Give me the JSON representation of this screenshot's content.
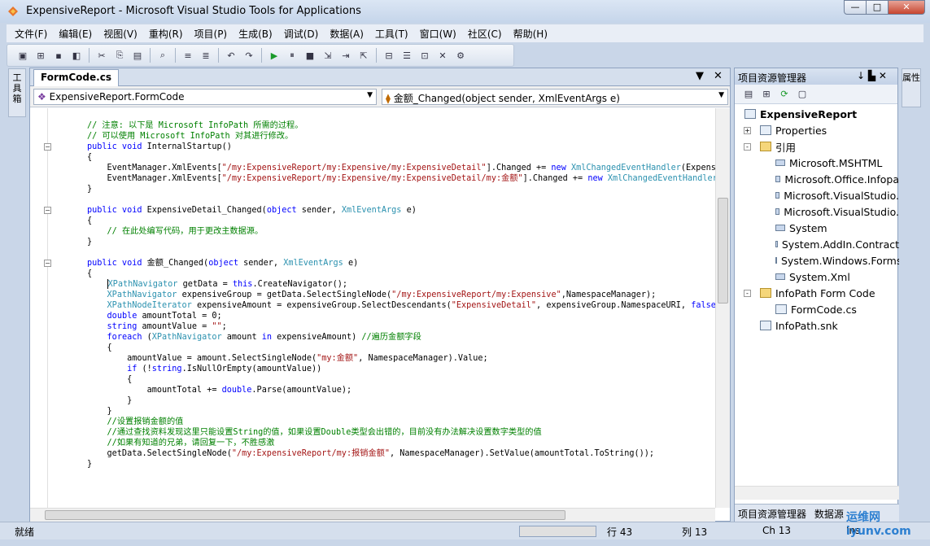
{
  "window": {
    "title": "ExpensiveReport - Microsoft Visual Studio Tools for Applications",
    "min": "—",
    "max": "□",
    "close": "✕"
  },
  "menu": [
    "文件(F)",
    "编辑(E)",
    "视图(V)",
    "重构(R)",
    "项目(P)",
    "生成(B)",
    "调试(D)",
    "数据(A)",
    "工具(T)",
    "窗口(W)",
    "社区(C)",
    "帮助(H)"
  ],
  "left_tab": "工具箱",
  "right_tab": "属性",
  "editor": {
    "tab_label": "FormCode.cs",
    "class_combo": "ExpensiveReport.FormCode",
    "member_combo": "金额_Changed(object sender, XmlEventArgs e)"
  },
  "code_lines": [
    [
      [
        "cm",
        "// 注意: 以下是 Microsoft InfoPath 所需的过程。"
      ]
    ],
    [
      [
        "cm",
        "// 可以使用 Microsoft InfoPath 对其进行修改。"
      ]
    ],
    [
      [
        "kw",
        "public void "
      ],
      [
        "",
        "InternalStartup()"
      ]
    ],
    [
      [
        "",
        "{"
      ]
    ],
    [
      [
        "",
        "    EventManager.XmlEvents["
      ],
      [
        "st",
        "\"/my:ExpensiveReport/my:Expensive/my:ExpensiveDetail\""
      ],
      [
        "",
        "].Changed += "
      ],
      [
        "kw",
        "new "
      ],
      [
        "ty",
        "XmlChangedEventHandler"
      ],
      [
        "",
        "(Expensiv"
      ]
    ],
    [
      [
        "",
        "    EventManager.XmlEvents["
      ],
      [
        "st",
        "\"/my:ExpensiveReport/my:Expensive/my:ExpensiveDetail/my:金额\""
      ],
      [
        "",
        "].Changed += "
      ],
      [
        "kw",
        "new "
      ],
      [
        "ty",
        "XmlChangedEventHandler"
      ],
      [
        "",
        "("
      ]
    ],
    [
      [
        "",
        "}"
      ]
    ],
    [
      [
        "",
        ""
      ]
    ],
    [
      [
        "kw",
        "public void "
      ],
      [
        "",
        "ExpensiveDetail_Changed("
      ],
      [
        "kw",
        "object "
      ],
      [
        "",
        "sender, "
      ],
      [
        "ty",
        "XmlEventArgs "
      ],
      [
        "",
        "e)"
      ]
    ],
    [
      [
        "",
        "{"
      ]
    ],
    [
      [
        "",
        "    "
      ],
      [
        "cm",
        "// 在此处编写代码，用于更改主数据源。"
      ]
    ],
    [
      [
        "",
        "}"
      ]
    ],
    [
      [
        "",
        ""
      ]
    ],
    [
      [
        "kw",
        "public void "
      ],
      [
        "",
        "金额_Changed("
      ],
      [
        "kw",
        "object "
      ],
      [
        "",
        "sender, "
      ],
      [
        "ty",
        "XmlEventArgs "
      ],
      [
        "",
        "e)"
      ]
    ],
    [
      [
        "",
        "{"
      ]
    ],
    [
      [
        "",
        "    "
      ],
      [
        "ty",
        "XPathNavigator "
      ],
      [
        "",
        "getData = "
      ],
      [
        "kw",
        "this"
      ],
      [
        "",
        ".CreateNavigator();"
      ]
    ],
    [
      [
        "",
        "    "
      ],
      [
        "ty",
        "XPathNavigator "
      ],
      [
        "",
        "expensiveGroup = getData.SelectSingleNode("
      ],
      [
        "st",
        "\"/my:ExpensiveReport/my:Expensive\""
      ],
      [
        "",
        ",NamespaceManager);"
      ]
    ],
    [
      [
        "",
        "    "
      ],
      [
        "ty",
        "XPathNodeIterator "
      ],
      [
        "",
        "expensiveAmount = expensiveGroup.SelectDescendants("
      ],
      [
        "st",
        "\"ExpensiveDetail\""
      ],
      [
        "",
        ", expensiveGroup.NamespaceURI, "
      ],
      [
        "kw",
        "false"
      ],
      [
        "",
        ");"
      ]
    ],
    [
      [
        "",
        "    "
      ],
      [
        "kw",
        "double "
      ],
      [
        "",
        "amountTotal = 0;"
      ]
    ],
    [
      [
        "",
        "    "
      ],
      [
        "kw",
        "string "
      ],
      [
        "",
        "amountValue = "
      ],
      [
        "st",
        "\"\""
      ],
      [
        "",
        ";"
      ]
    ],
    [
      [
        "",
        "    "
      ],
      [
        "kw",
        "foreach "
      ],
      [
        "",
        "("
      ],
      [
        "ty",
        "XPathNavigator "
      ],
      [
        "",
        "amount "
      ],
      [
        "kw",
        "in "
      ],
      [
        "",
        "expensiveAmount) "
      ],
      [
        "cm",
        "//遍历金额字段"
      ]
    ],
    [
      [
        "",
        "    {"
      ]
    ],
    [
      [
        "",
        "        amountValue = amount.SelectSingleNode("
      ],
      [
        "st",
        "\"my:金额\""
      ],
      [
        "",
        ", NamespaceManager).Value;"
      ]
    ],
    [
      [
        "",
        "        "
      ],
      [
        "kw",
        "if "
      ],
      [
        "",
        "(!"
      ],
      [
        "kw",
        "string"
      ],
      [
        "",
        ".IsNullOrEmpty(amountValue))"
      ]
    ],
    [
      [
        "",
        "        {"
      ]
    ],
    [
      [
        "",
        "            amountTotal += "
      ],
      [
        "kw",
        "double"
      ],
      [
        "",
        ".Parse(amountValue);"
      ]
    ],
    [
      [
        "",
        "        }"
      ]
    ],
    [
      [
        "",
        "    }"
      ]
    ],
    [
      [
        "",
        "    "
      ],
      [
        "cm",
        "//设置报销金额的值"
      ]
    ],
    [
      [
        "",
        "    "
      ],
      [
        "cm",
        "//通过查找资料发现这里只能设置String的值，如果设置Double类型会出错的，目前没有办法解决设置数字类型的值"
      ]
    ],
    [
      [
        "",
        "    "
      ],
      [
        "cm",
        "//如果有知道的兄弟，请回复一下，不胜感激"
      ]
    ],
    [
      [
        "",
        "    getData.SelectSingleNode("
      ],
      [
        "st",
        "\"/my:ExpensiveReport/my:报销金额\""
      ],
      [
        "",
        ", NamespaceManager).SetValue(amountTotal.ToString());"
      ]
    ],
    [
      [
        "",
        "}"
      ]
    ]
  ],
  "explorer": {
    "title": "项目资源管理器",
    "pin": "↓ ▙ ✕",
    "nodes": [
      {
        "label": "ExpensiveReport",
        "bold": true,
        "depth": 0,
        "kind": "project"
      },
      {
        "label": "Properties",
        "depth": 1,
        "kind": "file",
        "toggle": "+"
      },
      {
        "label": "引用",
        "depth": 1,
        "kind": "folder",
        "toggle": "-"
      },
      {
        "label": "Microsoft.MSHTML",
        "depth": 2,
        "kind": "ref"
      },
      {
        "label": "Microsoft.Office.Infopa",
        "depth": 2,
        "kind": "ref"
      },
      {
        "label": "Microsoft.VisualStudio.",
        "depth": 2,
        "kind": "ref"
      },
      {
        "label": "Microsoft.VisualStudio.",
        "depth": 2,
        "kind": "ref"
      },
      {
        "label": "System",
        "depth": 2,
        "kind": "ref"
      },
      {
        "label": "System.AddIn.Contract",
        "depth": 2,
        "kind": "ref"
      },
      {
        "label": "System.Windows.Forms",
        "depth": 2,
        "kind": "ref"
      },
      {
        "label": "System.Xml",
        "depth": 2,
        "kind": "ref"
      },
      {
        "label": "InfoPath Form Code",
        "depth": 1,
        "kind": "folder",
        "toggle": "-"
      },
      {
        "label": "FormCode.cs",
        "depth": 2,
        "kind": "file"
      },
      {
        "label": "InfoPath.snk",
        "depth": 1,
        "kind": "file"
      }
    ],
    "bottom_tab1": "项目资源管理器",
    "bottom_tab2": "数据源"
  },
  "status": {
    "ready": "就绪",
    "line": "行 43",
    "col": "列 13",
    "ch": "Ch 13",
    "ins": "Ins"
  },
  "watermark": "运维网 iyunv.com"
}
